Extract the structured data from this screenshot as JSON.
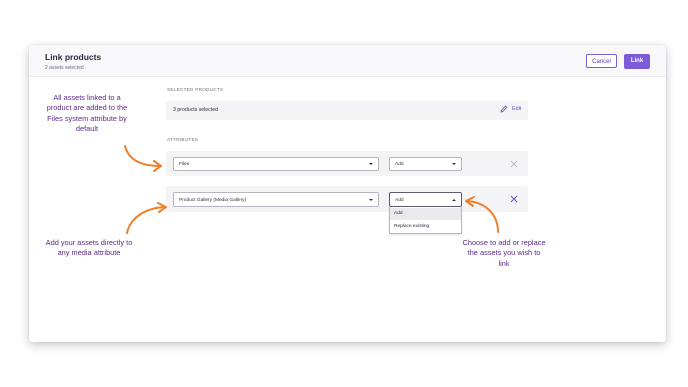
{
  "modal": {
    "title": "Link products",
    "subtitle": "2 assets selected",
    "cancel_label": "Cancel",
    "link_label": "Link"
  },
  "selected_products": {
    "section_label": "SELECTED PRODUCTS",
    "summary": "3 products selected",
    "edit_label": "Edit"
  },
  "attributes": {
    "section_label": "ATTRIBUTES",
    "rows": [
      {
        "attribute": "Files",
        "mode": "Add"
      },
      {
        "attribute": "Product Gallery (Media Gallery)",
        "mode": "Add",
        "open": true
      }
    ],
    "mode_options": [
      "Add",
      "Replace existing"
    ]
  },
  "annotations": {
    "left_top": "All assets linked to a product are added to the Files system attribute by default",
    "left_bottom": "Add your assets directly to any media attribute",
    "right_bottom": "Choose to add or replace the assets you wish to link"
  },
  "colors": {
    "accent": "#7c5cd8",
    "annotation_text": "#5d2a8c",
    "annotation_arrow": "#f07f2c"
  },
  "icons": [
    "pencil-icon",
    "close-icon",
    "caret-down-icon",
    "caret-up-icon"
  ]
}
